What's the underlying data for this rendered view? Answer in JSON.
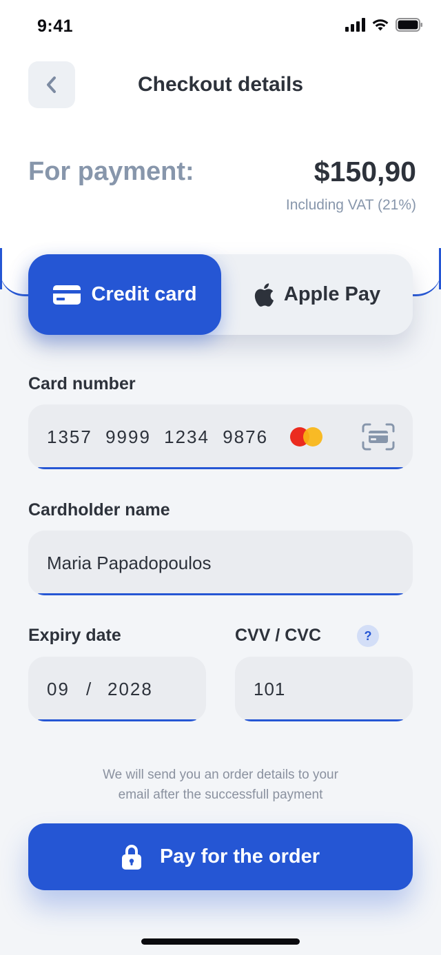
{
  "status_bar": {
    "time": "9:41"
  },
  "header": {
    "title": "Checkout details",
    "back_icon": "chevron-left-icon"
  },
  "summary": {
    "label": "For payment:",
    "amount": "$150,90",
    "vat_note": "Including VAT (21%)"
  },
  "payment_methods": {
    "selected": "credit_card",
    "credit_card_label": "Credit card",
    "apple_pay_label": "Apple Pay"
  },
  "form": {
    "card_number": {
      "label": "Card number",
      "value": "1357 9999 1234 9876",
      "brand": "mastercard"
    },
    "cardholder": {
      "label": "Cardholder name",
      "value": "Maria Papadopoulos"
    },
    "expiry": {
      "label": "Expiry date",
      "month": "09",
      "separator": "/",
      "year": "2028"
    },
    "cvv": {
      "label": "CVV / CVC",
      "value": "101",
      "help": "?"
    }
  },
  "notice": {
    "line1": "We will send you an order details to your",
    "line2": "email after the successfull payment"
  },
  "pay_button": {
    "label": "Pay for the order"
  },
  "colors": {
    "accent": "#2556d4",
    "muted": "#8796ab",
    "text": "#2d323b",
    "field_bg": "#eaecf0",
    "page_bg": "#f3f5f8"
  }
}
